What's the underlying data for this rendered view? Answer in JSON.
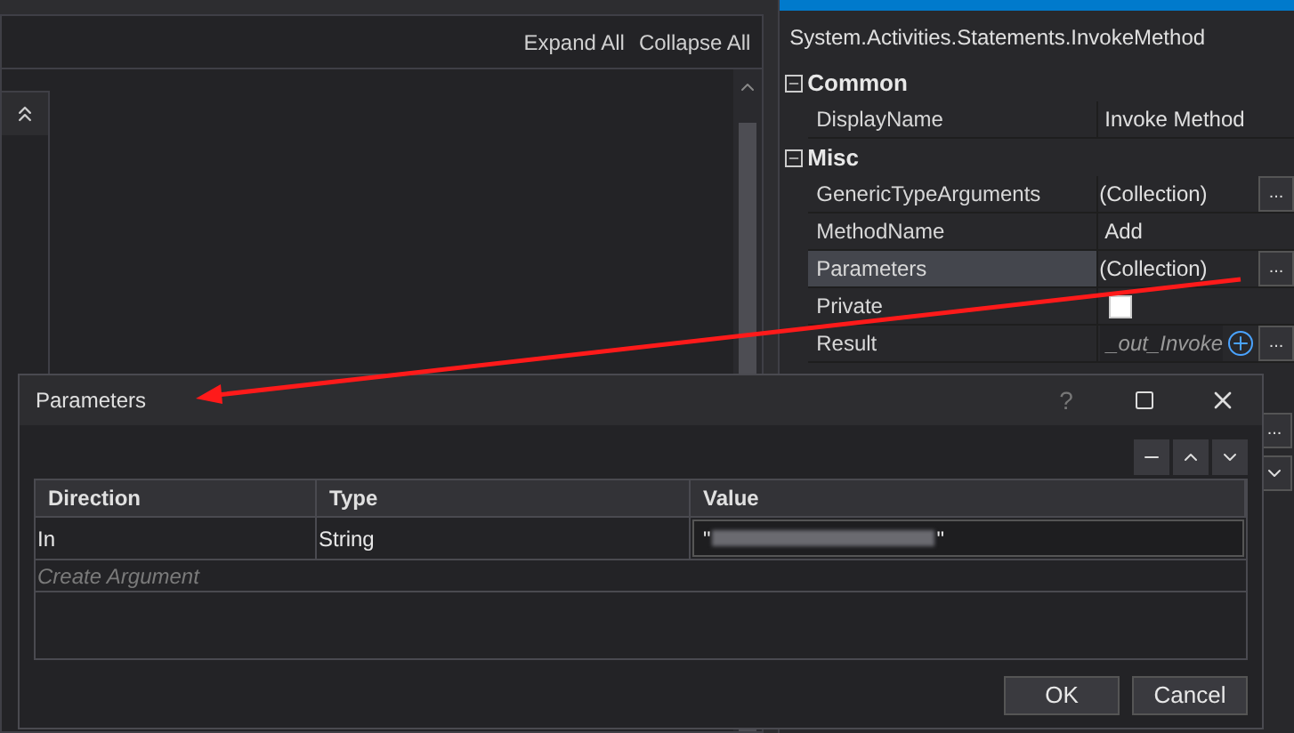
{
  "designer": {
    "expand_all": "Expand All",
    "collapse_all": "Collapse All"
  },
  "properties": {
    "type_name": "System.Activities.Statements.InvokeMethod",
    "categories": [
      {
        "name": "Common",
        "expanded": true,
        "rows": [
          {
            "kind": "text",
            "name": "DisplayName",
            "value": "Invoke Method",
            "selected": false
          }
        ]
      },
      {
        "name": "Misc",
        "expanded": true,
        "rows": [
          {
            "kind": "collection",
            "name": "GenericTypeArguments",
            "value": "(Collection)",
            "button": "...",
            "selected": false
          },
          {
            "kind": "text",
            "name": "MethodName",
            "value": "Add",
            "selected": false
          },
          {
            "kind": "collection",
            "name": "Parameters",
            "value": "(Collection)",
            "button": "...",
            "selected": true
          },
          {
            "kind": "checkbox",
            "name": "Private",
            "checked": false,
            "selected": false
          },
          {
            "kind": "variable",
            "name": "Result",
            "value": "_out_Invoke",
            "button": "...",
            "selected": false
          }
        ]
      }
    ],
    "hidden_button": "..."
  },
  "dialog": {
    "title": "Parameters",
    "help": "?",
    "columns": [
      "Direction",
      "Type",
      "Value"
    ],
    "rows": [
      {
        "direction": "In",
        "type": "String",
        "value_open": "\"",
        "value_close": "\""
      }
    ],
    "create_placeholder": "Create Argument",
    "buttons": [
      "OK",
      "Cancel"
    ]
  }
}
